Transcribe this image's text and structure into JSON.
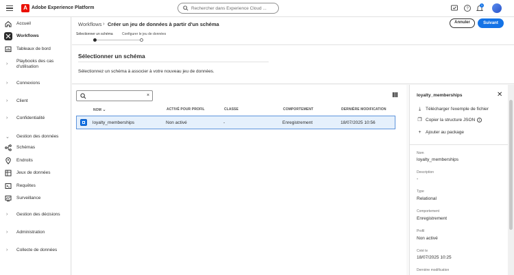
{
  "app": {
    "brand": "Adobe Experience Platform",
    "logo_letter": "A",
    "search_placeholder": "Rechercher dans Experience Cloud ...",
    "notification_count": "1"
  },
  "sidebar": {
    "items": [
      {
        "label": "Accueil",
        "icon": "home-icon"
      },
      {
        "label": "Workflows",
        "icon": "workflow-icon"
      },
      {
        "label": "Tableaux de bord",
        "icon": "dashboard-icon"
      },
      {
        "label": "Playbooks des cas d'utilisation",
        "icon": "chevron-right-icon"
      },
      {
        "label": "Connexions",
        "icon": "chevron-right-icon"
      },
      {
        "label": "Client",
        "icon": "chevron-right-icon"
      },
      {
        "label": "Confidentialité",
        "icon": "chevron-right-icon"
      },
      {
        "label": "Gestion des données",
        "icon": "chevron-down-icon"
      },
      {
        "label": "Schémas",
        "icon": "schema-icon"
      },
      {
        "label": "Endroits",
        "icon": "location-icon"
      },
      {
        "label": "Jeux de données",
        "icon": "dataset-icon"
      },
      {
        "label": "Requêtes",
        "icon": "query-icon"
      },
      {
        "label": "Surveillance",
        "icon": "monitor-icon"
      },
      {
        "label": "Gestion des décisions",
        "icon": "chevron-right-icon"
      },
      {
        "label": "Administration",
        "icon": "chevron-right-icon"
      },
      {
        "label": "Collecte de données",
        "icon": "chevron-right-icon"
      }
    ]
  },
  "header": {
    "breadcrumb_root": "Workflows",
    "breadcrumb_current": "Créer un jeu de données à partir d'un schéma",
    "steps": [
      "Sélectionner un schéma",
      "Configurer le jeu de données"
    ],
    "cancel_label": "Annuler",
    "next_label": "Suivant"
  },
  "section": {
    "title": "Sélectionner un schéma",
    "description": "Sélectionnez un schéma à associer à votre nouveau jeu de données."
  },
  "table": {
    "search_value": "",
    "clear_glyph": "×",
    "columns": [
      "NOM",
      "ACTIVÉ POUR PROFIL",
      "CLASSE",
      "COMPORTEMENT",
      "DERNIÈRE MODIFICATION"
    ],
    "rows": [
      {
        "name": "loyalty_memberships",
        "profile": "Non activé",
        "class": "-",
        "behavior": "Enregistrement",
        "modified": "18/07/2025 10:56",
        "selected": true
      }
    ]
  },
  "panel": {
    "title": "loyalty_memberships",
    "close_glyph": "✕",
    "actions": [
      {
        "label": "Télécharger l'exemple de fichier",
        "icon": "download-icon"
      },
      {
        "label": "Copier la structure JSON",
        "icon": "copy-icon"
      },
      {
        "label": "Ajouter au package",
        "icon": "add-icon"
      }
    ],
    "info_glyph": "i",
    "fields": [
      {
        "label": "Nom",
        "value": "loyalty_memberships"
      },
      {
        "label": "Description",
        "value": "-"
      },
      {
        "label": "Type",
        "value": "Relational"
      },
      {
        "label": "Comportement",
        "value": "Enregistrement"
      },
      {
        "label": "Profil",
        "value": "Non activé"
      },
      {
        "label": "Créé le",
        "value": "18/07/2025 10:25"
      },
      {
        "label": "Dernière modification",
        "value": ""
      }
    ]
  },
  "colors": {
    "accent": "#1473e6",
    "selected_row_bg": "#e5f0fc",
    "selected_row_border": "#5c93dc",
    "brand_red": "#eb1000"
  }
}
